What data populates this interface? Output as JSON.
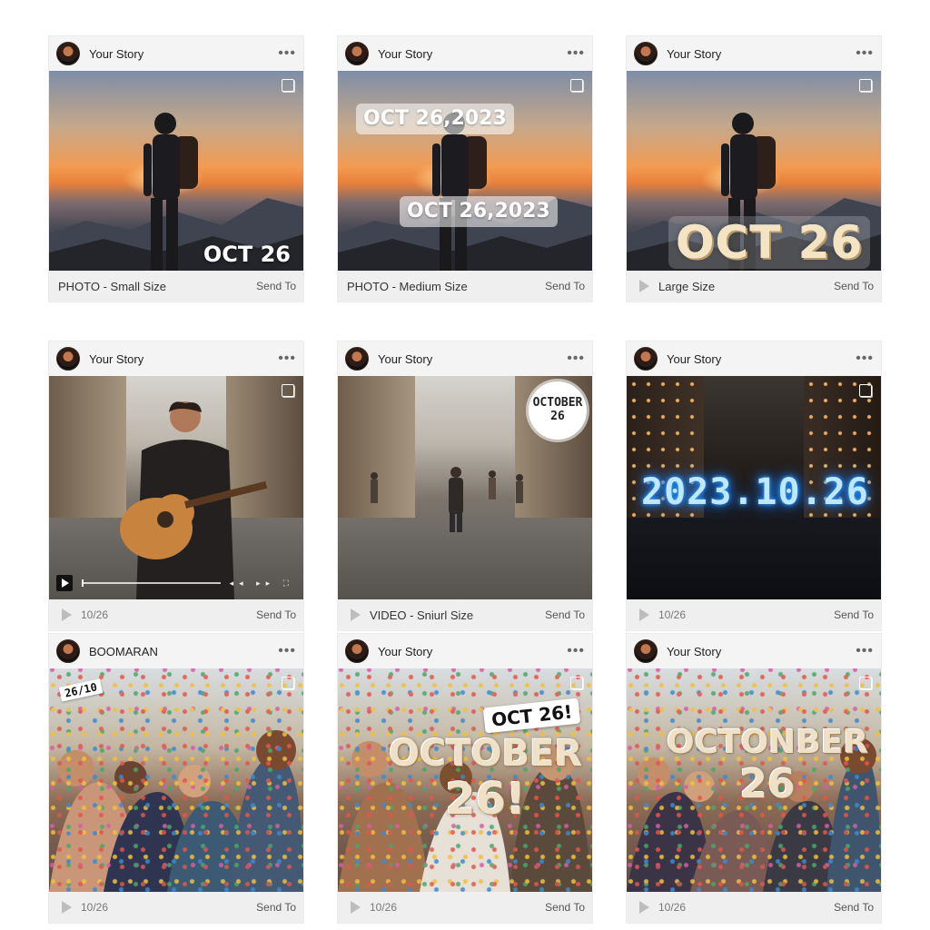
{
  "cards": [
    {
      "author": "Your Story",
      "overlay": "OCT 26",
      "footer_label": "PHOTO - Small Size",
      "send_to": "Send To"
    },
    {
      "author": "Your Story",
      "overlay_top": "OCT 26,2023",
      "overlay": "OCT 26,2023",
      "footer_label": "PHOTO - Medium Size",
      "send_to": "Send To"
    },
    {
      "author": "Your Story",
      "overlay": "OCT 26",
      "footer_label": "Large Size",
      "send_to": "Send To"
    },
    {
      "author": "Your Story",
      "footer_label": "10/26",
      "send_to": "Send To"
    },
    {
      "author": "Your Story",
      "overlay_line1": "OCTOBER",
      "overlay_line2": "26",
      "footer_label": "VIDEO - Sniurl Size",
      "send_to": "Send To"
    },
    {
      "author": "Your Story",
      "overlay": "2023.10.26",
      "footer_label": "10/26",
      "send_to": "Send To"
    },
    {
      "author": "BOOMARAN",
      "overlay": "26/10",
      "footer_label": "10/26",
      "send_to": "Send To"
    },
    {
      "author": "Your Story",
      "overlay_sticker": "OCT 26!",
      "overlay_line1": "OCTOBER",
      "overlay_line2": "26!",
      "footer_label": "10/26",
      "send_to": "Send To"
    },
    {
      "author": "Your Story",
      "overlay_line1": "OCTONBER",
      "overlay_line2": "26",
      "footer_label": "10/26",
      "send_to": "Send To"
    }
  ],
  "icons": {
    "more": "more-icon",
    "gallery": "gallery-icon",
    "play": "play-icon"
  },
  "colors": {
    "card_bg": "#f2f2f2",
    "neon_blue": "#1a7dff"
  }
}
